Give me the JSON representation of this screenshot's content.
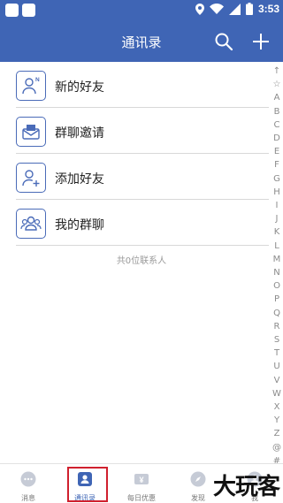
{
  "status_bar": {
    "time": "3:53"
  },
  "header": {
    "title": "通讯录"
  },
  "items": [
    {
      "label": "新的好友",
      "icon": "new-friend-icon"
    },
    {
      "label": "群聊邀请",
      "icon": "group-invite-icon"
    },
    {
      "label": "添加好友",
      "icon": "add-friend-icon"
    },
    {
      "label": "我的群聊",
      "icon": "my-groups-icon"
    }
  ],
  "contact_count": "共0位联系人",
  "index_letters": [
    "↑",
    "☆",
    "A",
    "B",
    "C",
    "D",
    "E",
    "F",
    "G",
    "H",
    "I",
    "J",
    "K",
    "L",
    "M",
    "N",
    "O",
    "P",
    "Q",
    "R",
    "S",
    "T",
    "U",
    "V",
    "W",
    "X",
    "Y",
    "Z",
    "@",
    "#"
  ],
  "tabs": [
    {
      "label": "消息",
      "icon": "chat-bubble-icon"
    },
    {
      "label": "通讯录",
      "icon": "contacts-icon",
      "active": true
    },
    {
      "label": "每日优惠",
      "icon": "yen-coupon-icon"
    },
    {
      "label": "发现",
      "icon": "discover-icon"
    },
    {
      "label": "我",
      "icon": "me-icon"
    }
  ],
  "watermark": "大玩客",
  "colors": {
    "primary": "#3f65b5",
    "highlight": "#d0202e"
  }
}
